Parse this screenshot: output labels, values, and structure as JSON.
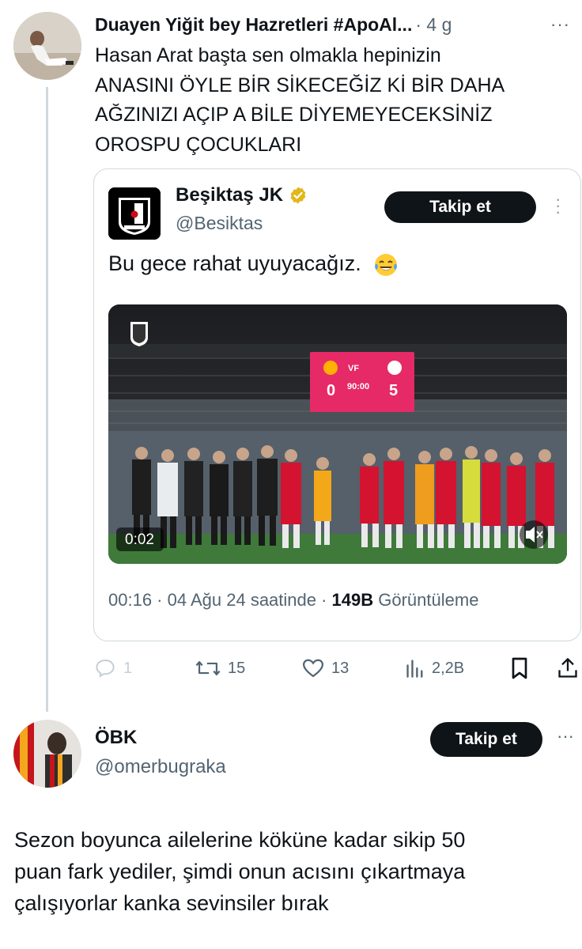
{
  "reply1": {
    "name": "Duayen Yiğit bey Hazretleri #ApoAl...",
    "time": "· 4 g",
    "more": "···",
    "lines": [
      "Hasan Arat başta sen olmakla hepinizin",
      "ANASINI ÖYLE BİR SİKECEĞİZ Kİ BİR DAHA",
      "AĞZINIZI AÇIP A BİLE DİYEMEYECEKSİNİZ",
      "OROSPU ÇOCUKLARI"
    ]
  },
  "quote": {
    "name": "Beşiktaş JK",
    "handle": "@Besiktas",
    "follow_label": "Takip et",
    "text": "Bu gece rahat uyuyacağız.",
    "emoji_name": "face-with-tears-of-joy",
    "video": {
      "duration": "0:02",
      "score_left": "0",
      "score_right": "5",
      "clock": "90:00"
    },
    "meta_date": "00:16 · 04 Ağu 24 saatinde · ",
    "meta_views": "149B",
    "meta_views_label": " Görüntüleme"
  },
  "actions": {
    "replies": "1",
    "retweets": "15",
    "likes": "13",
    "views": "2,2B"
  },
  "reply2": {
    "name": "ÖBK",
    "handle": "@omerbugraka",
    "follow_label": "Takip et",
    "more": "···",
    "lines": [
      "Sezon boyunca ailelerine köküne kadar sikip 50",
      "puan fark yediler, şimdi onun acısını çıkartmaya",
      "çalışıyorlar kanka sevinsiler bırak"
    ]
  },
  "colors": {
    "text": "#0f1419",
    "muted": "#536471",
    "border": "#cfd9de",
    "button": "#0f1419",
    "verified_gold": "#e2b719",
    "scoreboard": "#e62a67"
  }
}
